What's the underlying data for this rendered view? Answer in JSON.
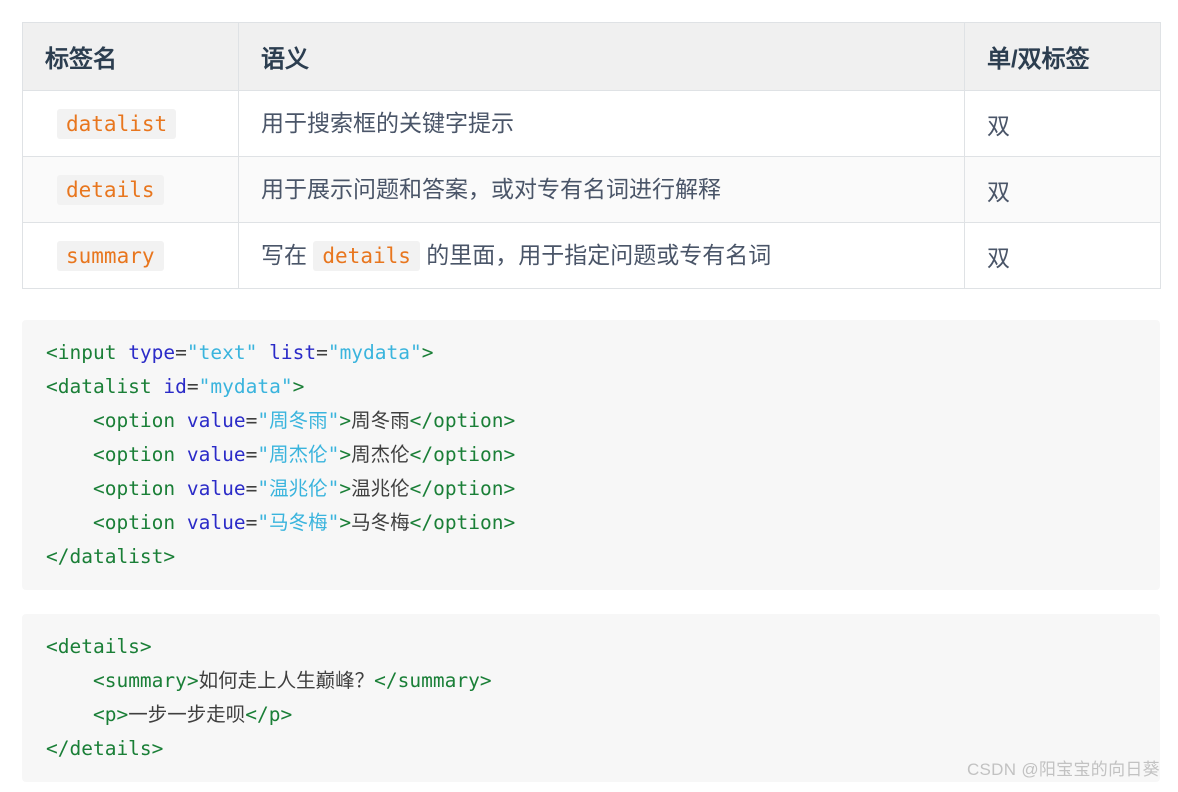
{
  "table": {
    "headers": [
      "标签名",
      "语义",
      "单/双标签"
    ],
    "rows": [
      {
        "tag": "datalist",
        "semantic_prefix": "用于搜索框的关键字提示",
        "semantic_code": "",
        "semantic_suffix": "",
        "pair": "双"
      },
      {
        "tag": "details",
        "semantic_prefix": "用于展示问题和答案，或对专有名词进行解释",
        "semantic_code": "",
        "semantic_suffix": "",
        "pair": "双"
      },
      {
        "tag": "summary",
        "semantic_prefix": "写在 ",
        "semantic_code": "details",
        "semantic_suffix": " 的里面，用于指定问题或专有名词",
        "pair": "双"
      }
    ]
  },
  "code_blocks": [
    {
      "name": "datalist-example",
      "lines": [
        [
          {
            "t": "tag",
            "s": "<input "
          },
          {
            "t": "attr",
            "s": "type"
          },
          {
            "t": "txt",
            "s": "="
          },
          {
            "t": "val",
            "s": "\"text\""
          },
          {
            "t": "txt",
            "s": " "
          },
          {
            "t": "attr",
            "s": "list"
          },
          {
            "t": "txt",
            "s": "="
          },
          {
            "t": "val",
            "s": "\"mydata\""
          },
          {
            "t": "tag",
            "s": ">"
          }
        ],
        [
          {
            "t": "tag",
            "s": "<datalist "
          },
          {
            "t": "attr",
            "s": "id"
          },
          {
            "t": "txt",
            "s": "="
          },
          {
            "t": "val",
            "s": "\"mydata\""
          },
          {
            "t": "tag",
            "s": ">"
          }
        ],
        [
          {
            "t": "txt",
            "s": "    "
          },
          {
            "t": "tag",
            "s": "<option "
          },
          {
            "t": "attr",
            "s": "value"
          },
          {
            "t": "txt",
            "s": "="
          },
          {
            "t": "val",
            "s": "\"周冬雨\""
          },
          {
            "t": "tag",
            "s": ">"
          },
          {
            "t": "txt",
            "s": "周冬雨"
          },
          {
            "t": "tag",
            "s": "</option>"
          }
        ],
        [
          {
            "t": "txt",
            "s": "    "
          },
          {
            "t": "tag",
            "s": "<option "
          },
          {
            "t": "attr",
            "s": "value"
          },
          {
            "t": "txt",
            "s": "="
          },
          {
            "t": "val",
            "s": "\"周杰伦\""
          },
          {
            "t": "tag",
            "s": ">"
          },
          {
            "t": "txt",
            "s": "周杰伦"
          },
          {
            "t": "tag",
            "s": "</option>"
          }
        ],
        [
          {
            "t": "txt",
            "s": "    "
          },
          {
            "t": "tag",
            "s": "<option "
          },
          {
            "t": "attr",
            "s": "value"
          },
          {
            "t": "txt",
            "s": "="
          },
          {
            "t": "val",
            "s": "\"温兆伦\""
          },
          {
            "t": "tag",
            "s": ">"
          },
          {
            "t": "txt",
            "s": "温兆伦"
          },
          {
            "t": "tag",
            "s": "</option>"
          }
        ],
        [
          {
            "t": "txt",
            "s": "    "
          },
          {
            "t": "tag",
            "s": "<option "
          },
          {
            "t": "attr",
            "s": "value"
          },
          {
            "t": "txt",
            "s": "="
          },
          {
            "t": "val",
            "s": "\"马冬梅\""
          },
          {
            "t": "tag",
            "s": ">"
          },
          {
            "t": "txt",
            "s": "马冬梅"
          },
          {
            "t": "tag",
            "s": "</option>"
          }
        ],
        [
          {
            "t": "tag",
            "s": "</datalist>"
          }
        ]
      ]
    },
    {
      "name": "details-example",
      "lines": [
        [
          {
            "t": "tag",
            "s": "<details>"
          }
        ],
        [
          {
            "t": "txt",
            "s": "    "
          },
          {
            "t": "tag",
            "s": "<summary>"
          },
          {
            "t": "txt",
            "s": "如何走上人生巅峰？"
          },
          {
            "t": "tag",
            "s": "</summary>"
          }
        ],
        [
          {
            "t": "txt",
            "s": "    "
          },
          {
            "t": "tag",
            "s": "<p>"
          },
          {
            "t": "txt",
            "s": "一步一步走呗"
          },
          {
            "t": "tag",
            "s": "</p>"
          }
        ],
        [
          {
            "t": "tag",
            "s": "</details>"
          }
        ]
      ]
    }
  ],
  "watermark": "CSDN @阳宝宝的向日葵",
  "colors": {
    "tag": "#1a7f37",
    "attr": "#2b2bc8",
    "value": "#3ab4dd",
    "text": "#3f3f3f",
    "inline_code": "#e8761e",
    "header_text": "#2c3e50",
    "body_text": "#4a5568",
    "code_bg": "#f7f7f7",
    "table_header_bg": "#f0f0f0",
    "table_border": "#dfe2e5",
    "watermark": "#c2c2c2"
  }
}
